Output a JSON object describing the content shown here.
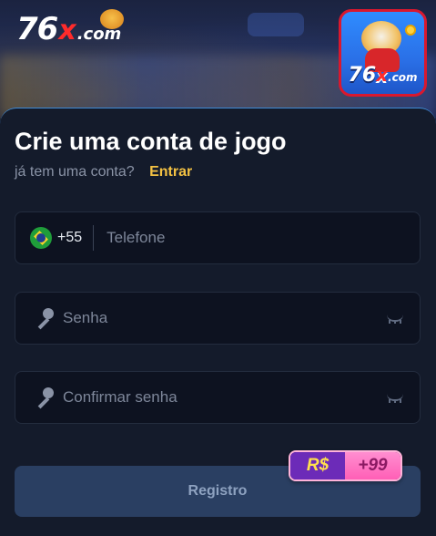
{
  "header": {
    "logo_number": "76",
    "logo_x": "x",
    "logo_domain": ".com"
  },
  "app_icon": {
    "number": "76",
    "x": "x",
    "domain": ".com"
  },
  "form": {
    "title": "Crie uma conta de jogo",
    "subtitle": "já tem uma conta?",
    "login_link": "Entrar",
    "phone": {
      "country_code": "+55",
      "placeholder": "Telefone"
    },
    "password": {
      "placeholder": "Senha"
    },
    "confirm_password": {
      "placeholder": "Confirmar senha"
    },
    "register_button": "Registro",
    "bonus": {
      "currency": "R$",
      "amount": "+99"
    }
  },
  "colors": {
    "accent_link": "#f4c243",
    "logo_red": "#ff2b2b",
    "button_bg": "#2a3f62"
  }
}
